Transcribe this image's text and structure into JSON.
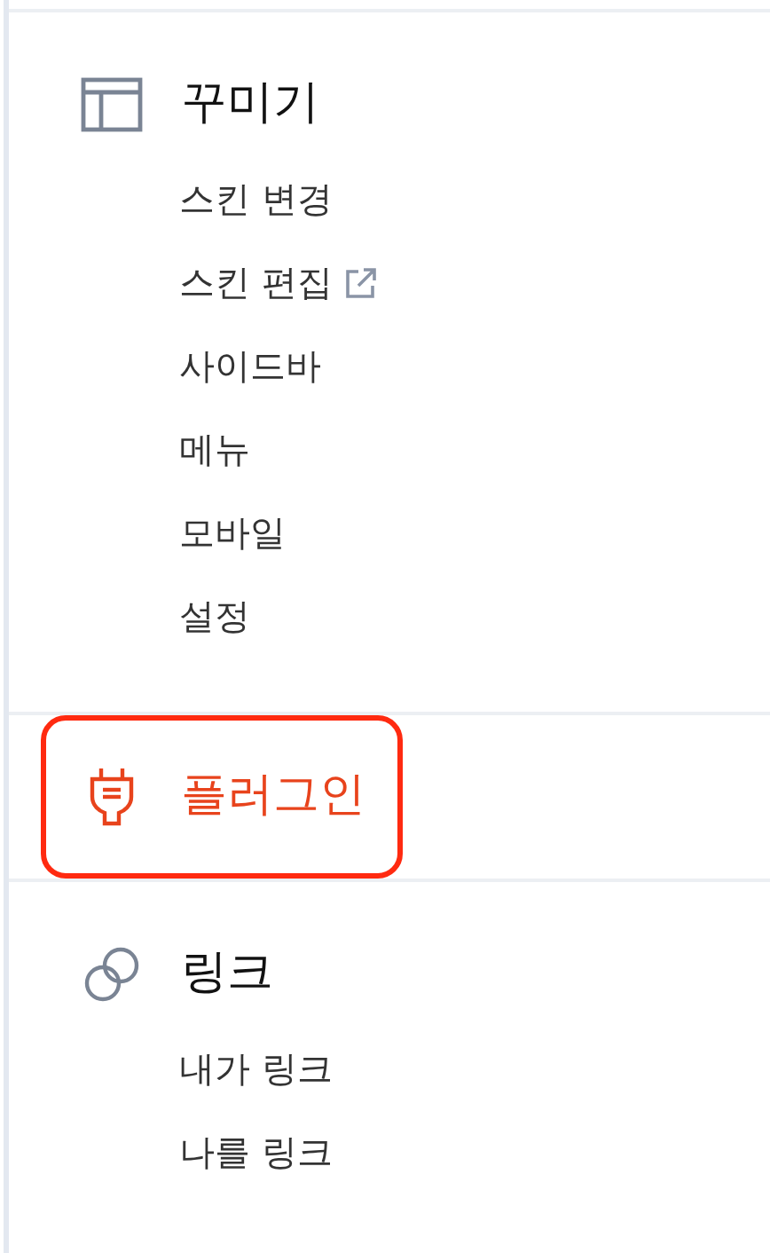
{
  "sections": [
    {
      "title": "꾸미기",
      "active": false,
      "items": [
        {
          "label": "스킨 변경",
          "external": false
        },
        {
          "label": "스킨 편집",
          "external": true
        },
        {
          "label": "사이드바",
          "external": false
        },
        {
          "label": "메뉴",
          "external": false
        },
        {
          "label": "모바일",
          "external": false
        },
        {
          "label": "설정",
          "external": false
        }
      ]
    },
    {
      "title": "플러그인",
      "active": true
    },
    {
      "title": "링크",
      "active": false,
      "items": [
        {
          "label": "내가 링크",
          "external": false
        },
        {
          "label": "나를 링크",
          "external": false
        }
      ]
    }
  ]
}
